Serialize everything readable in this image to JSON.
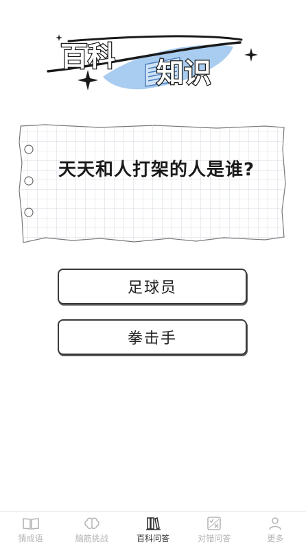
{
  "header": {
    "title_line1": "百科",
    "title_line2": "知识"
  },
  "question": {
    "text": "天天和人打架的人是谁?"
  },
  "answers": [
    {
      "label": "足球员"
    },
    {
      "label": "拳击手"
    }
  ],
  "tabs": [
    {
      "label": "猜成语",
      "icon": "book-icon"
    },
    {
      "label": "脑筋挑战",
      "icon": "brain-icon"
    },
    {
      "label": "百科问答",
      "icon": "books-icon",
      "active": true
    },
    {
      "label": "对错问答",
      "icon": "true-false-icon"
    },
    {
      "label": "更多",
      "icon": "more-user-icon"
    }
  ]
}
